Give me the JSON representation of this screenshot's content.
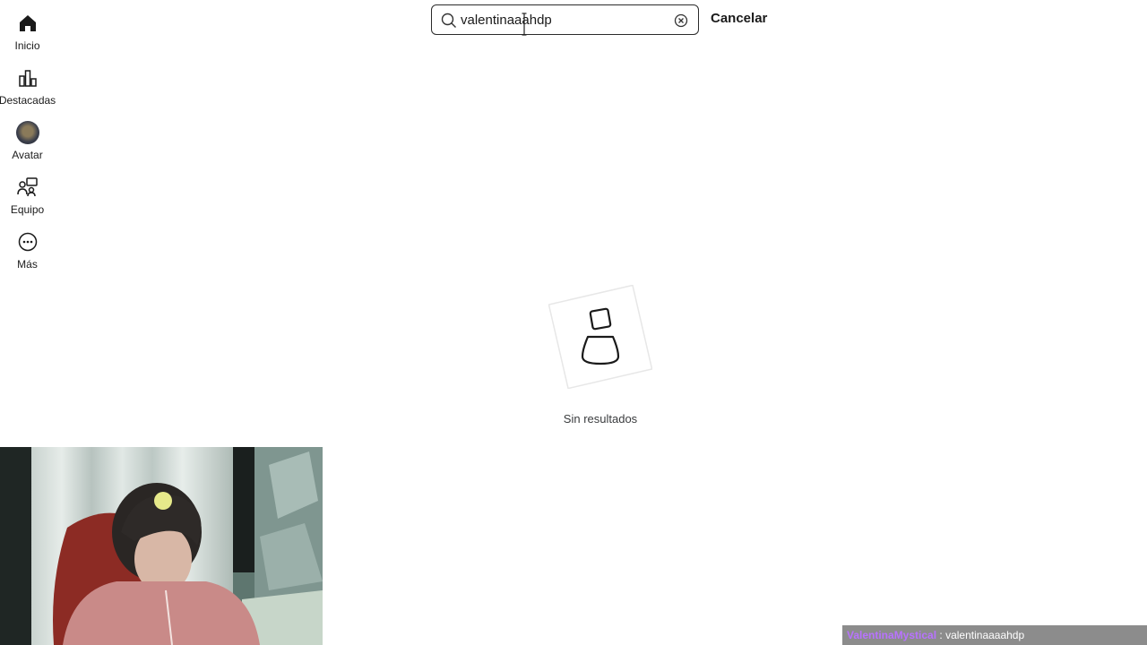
{
  "sidebar": {
    "items": [
      {
        "label": "Inicio",
        "icon": "home-icon"
      },
      {
        "label": "Destacadas",
        "icon": "charts-icon"
      },
      {
        "label": "Avatar",
        "icon": "avatar-thumbnail"
      },
      {
        "label": "Equipo",
        "icon": "team-icon"
      },
      {
        "label": "Más",
        "icon": "more-icon"
      }
    ]
  },
  "search": {
    "value": "valentinaaahdp",
    "cancel_label": "Cancelar"
  },
  "results": {
    "empty_text": "Sin resultados"
  },
  "chat": {
    "username": "ValentinaMystical",
    "separator": ":",
    "message": "valentinaaaahdp"
  }
}
